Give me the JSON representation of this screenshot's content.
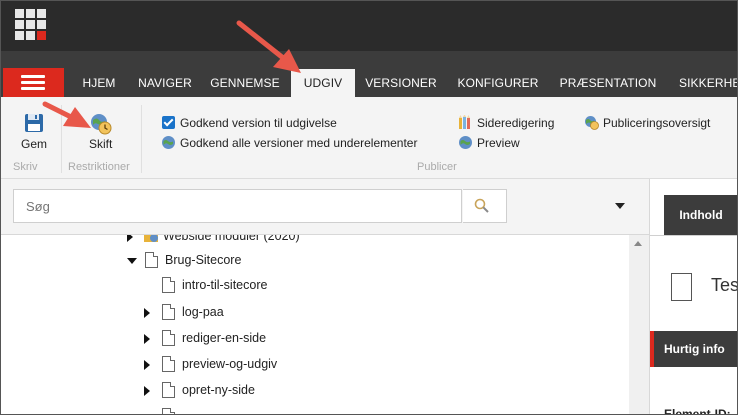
{
  "header": {
    "app_grid_icon": "app-grid-icon"
  },
  "ribbon_tabs": [
    {
      "label": "HJEM",
      "active": false
    },
    {
      "label": "NAVIGER",
      "active": false
    },
    {
      "label": "GENNEMSE",
      "active": false
    },
    {
      "label": "UDGIV",
      "active": true
    },
    {
      "label": "VERSIONER",
      "active": false
    },
    {
      "label": "KONFIGURER",
      "active": false
    },
    {
      "label": "PRÆSENTATION",
      "active": false
    },
    {
      "label": "SIKKERHE",
      "active": false
    }
  ],
  "ribbon": {
    "save_label": "Gem",
    "change_label": "Skift",
    "group_write": "Skriv",
    "group_restrictions": "Restriktioner",
    "group_publish": "Publicer",
    "approve_version": "Godkend version til udgivelse",
    "approve_version_checked": true,
    "approve_all": "Godkend alle versioner med underelementer",
    "page_editing": "Sideredigering",
    "preview": "Preview",
    "publishing_overview": "Publiceringsoversigt"
  },
  "search": {
    "placeholder": "Søg"
  },
  "tree": {
    "items": [
      {
        "label": "Webside moduler (2020)",
        "expander": "right"
      },
      {
        "label": "Brug-Sitecore",
        "expander": "down"
      },
      {
        "label": "intro-til-sitecore",
        "expander": "none"
      },
      {
        "label": "log-paa",
        "expander": "right"
      },
      {
        "label": "rediger-en-side",
        "expander": "right"
      },
      {
        "label": "preview-og-udgiv",
        "expander": "right"
      },
      {
        "label": "opret-ny-side",
        "expander": "right"
      }
    ]
  },
  "content_panel": {
    "tab_label": "Indhold",
    "item_title": "Tes",
    "quick_info": "Hurtig info",
    "element_id_label": "Element-ID:"
  },
  "colors": {
    "accent_red": "#dc291e",
    "dark_bar": "#2b2b2b",
    "tab_bar": "#3c3c3c",
    "annotation_arrow": "#e8584a"
  }
}
